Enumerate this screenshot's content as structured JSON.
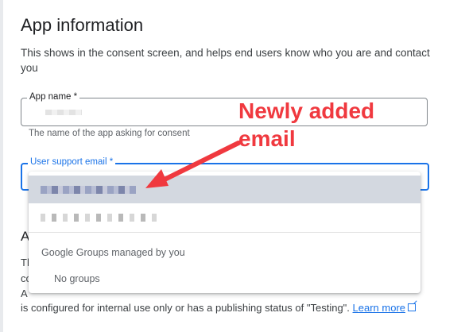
{
  "section": {
    "title": "App information",
    "description": "This shows in the consent screen, and helps end users know who you are and contact you"
  },
  "app_name_field": {
    "label": "App name *",
    "hint": "The name of the app asking for consent"
  },
  "user_support_email_field": {
    "label": "User support email *"
  },
  "dropdown": {
    "group_header": "Google Groups managed by you",
    "no_groups": "No groups"
  },
  "background_text": {
    "heading_fragment": "A",
    "line1": "Th",
    "line2": "co",
    "line3": "A",
    "bottom": "is configured for internal use only or has a publishing status of \"Testing\".",
    "learn_more": "Learn more"
  },
  "annotation": {
    "text": "Newly added email",
    "color": "#f0393f"
  },
  "colors": {
    "accent": "#1a73e8",
    "selected_option": "#d3d8e0"
  },
  "icons": {
    "external_link": "open-in-new-icon"
  }
}
